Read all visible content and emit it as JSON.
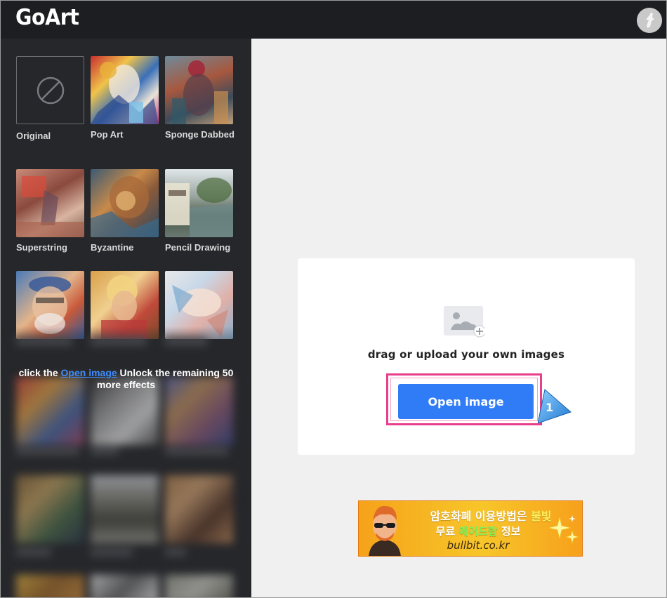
{
  "app": {
    "logo": "GoArt"
  },
  "sidebar": {
    "effects": [
      {
        "label": "Original",
        "icon": "no-symbol-icon"
      },
      {
        "label": "Pop Art"
      },
      {
        "label": "Sponge Dabbed"
      },
      {
        "label": "Superstring"
      },
      {
        "label": "Byzantine"
      },
      {
        "label": "Pencil Drawing"
      }
    ],
    "unlock": {
      "prefix": "click the ",
      "link": "Open image",
      "suffix": " Unlock the remaining 50 more effects"
    }
  },
  "upload": {
    "prompt": "drag or upload your own images",
    "button_label": "Open image",
    "step_number": "1"
  },
  "banner": {
    "line1_prefix": "암호화폐 이용방법은 ",
    "line1_highlight": "불빛",
    "line2_prefix": "무료 ",
    "line2_highlight": "에어드랍",
    "line2_suffix": " 정보",
    "url": "bullbit.co.kr"
  },
  "colors": {
    "topbar": "#1d1e22",
    "sidebar": "#26272b",
    "main_bg": "#f0f0f0",
    "button": "#2f7cf6",
    "highlight": "#e83e8c",
    "link": "#3d8cff"
  }
}
